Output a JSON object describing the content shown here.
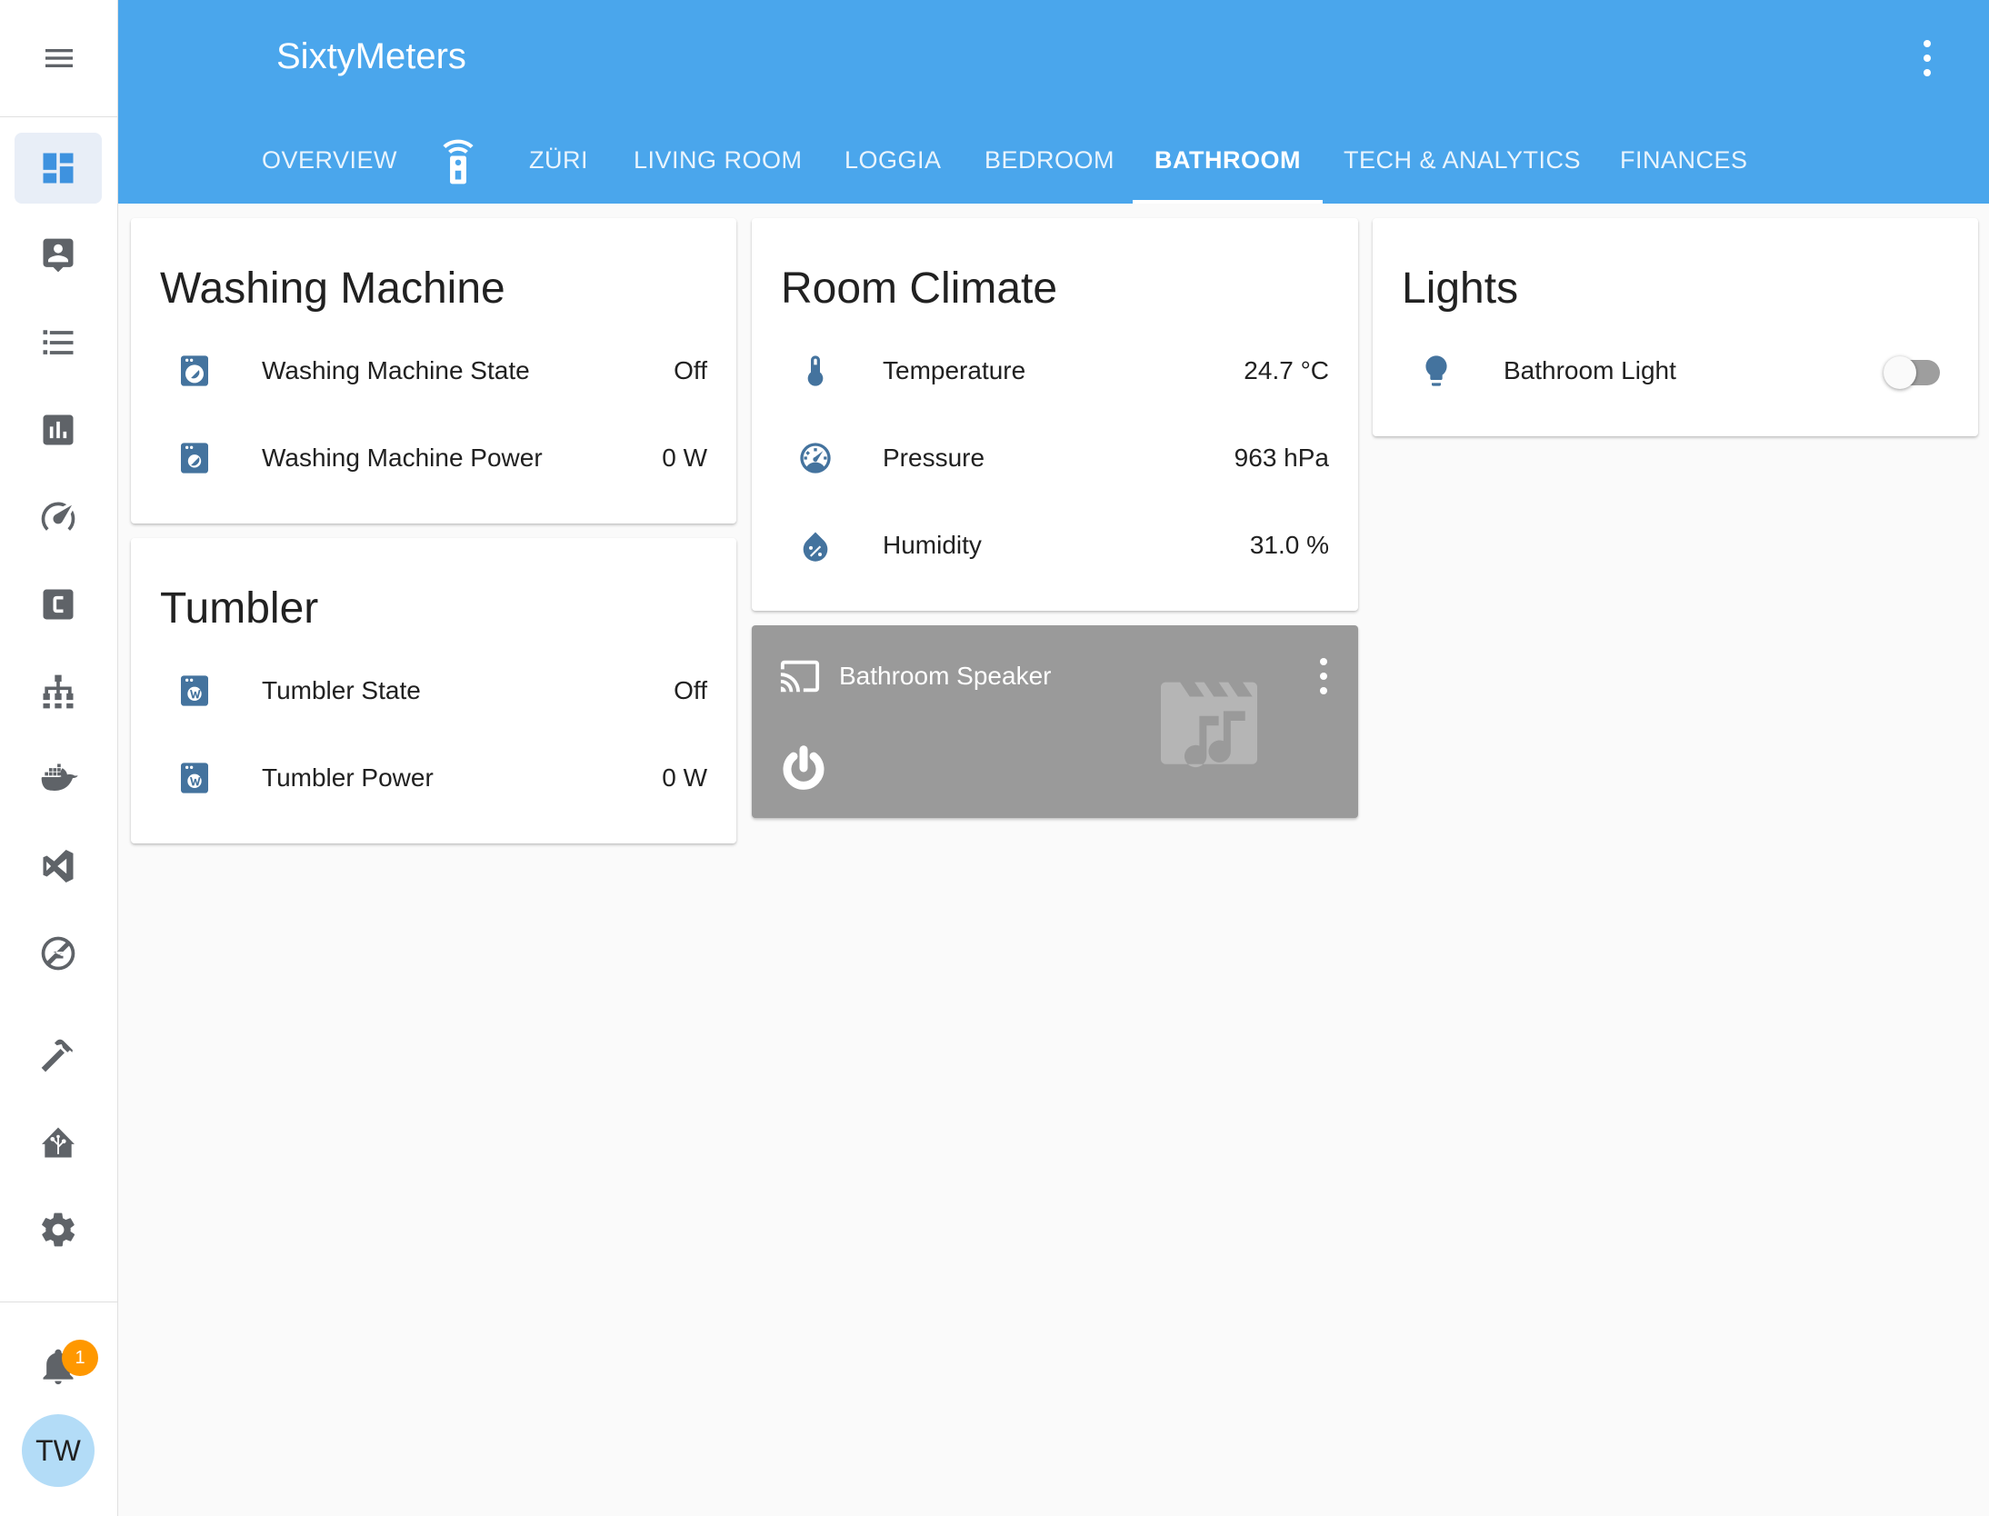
{
  "app": {
    "title": "SixtyMeters"
  },
  "colors": {
    "header": "#4aa6ec",
    "accent": "#3e92df",
    "icon": "#44739e",
    "badge": "#ff9800"
  },
  "sidebar": {
    "menu_icon": "hamburger-menu-icon",
    "items": [
      {
        "icon": "dashboard-icon",
        "active": true
      },
      {
        "icon": "account-box-icon"
      },
      {
        "icon": "logbook-list-icon"
      },
      {
        "icon": "history-chart-icon"
      },
      {
        "icon": "speedometer-icon"
      },
      {
        "icon": "c-box-icon"
      },
      {
        "icon": "network-hierarchy-icon"
      },
      {
        "icon": "docker-whale-icon"
      },
      {
        "icon": "vscode-icon"
      },
      {
        "icon": "zwave-icon"
      },
      {
        "icon": "hammer-icon"
      },
      {
        "icon": "home-assistant-icon"
      },
      {
        "icon": "settings-gear-icon"
      }
    ],
    "notifications": {
      "icon": "bell-icon",
      "count": "1"
    },
    "user": {
      "initials": "TW"
    }
  },
  "header": {
    "menu_icon": "more-vertical-icon",
    "tabs": [
      {
        "label": "OVERVIEW"
      },
      {
        "label": "",
        "icon": "remote-wifi-icon"
      },
      {
        "label": "ZÜRI"
      },
      {
        "label": "LIVING ROOM"
      },
      {
        "label": "LOGGIA"
      },
      {
        "label": "BEDROOM"
      },
      {
        "label": "BATHROOM",
        "active": true
      },
      {
        "label": "TECH & ANALYTICS"
      },
      {
        "label": "FINANCES"
      }
    ]
  },
  "cards": {
    "washing_machine": {
      "title": "Washing Machine",
      "rows": [
        {
          "icon": "washing-machine-icon",
          "label": "Washing Machine State",
          "value": "Off"
        },
        {
          "icon": "washing-machine-icon",
          "label": "Washing Machine Power",
          "value": "0 W"
        }
      ]
    },
    "tumbler": {
      "title": "Tumbler",
      "rows": [
        {
          "icon": "tumble-dryer-icon",
          "label": "Tumbler State",
          "value": "Off"
        },
        {
          "icon": "tumble-dryer-icon",
          "label": "Tumbler Power",
          "value": "0 W"
        }
      ]
    },
    "room_climate": {
      "title": "Room Climate",
      "rows": [
        {
          "icon": "thermometer-icon",
          "label": "Temperature",
          "value": "24.7 °C"
        },
        {
          "icon": "gauge-icon",
          "label": "Pressure",
          "value": "963 hPa"
        },
        {
          "icon": "water-percent-icon",
          "label": "Humidity",
          "value": "31.0 %"
        }
      ]
    },
    "lights": {
      "title": "Lights",
      "rows": [
        {
          "icon": "lightbulb-icon",
          "label": "Bathroom Light",
          "state": "off"
        }
      ]
    },
    "media": {
      "name": "Bathroom Speaker",
      "cast_icon": "cast-icon",
      "art_icon": "movie-music-icon",
      "power_icon": "power-icon",
      "menu_icon": "more-vertical-icon"
    }
  }
}
